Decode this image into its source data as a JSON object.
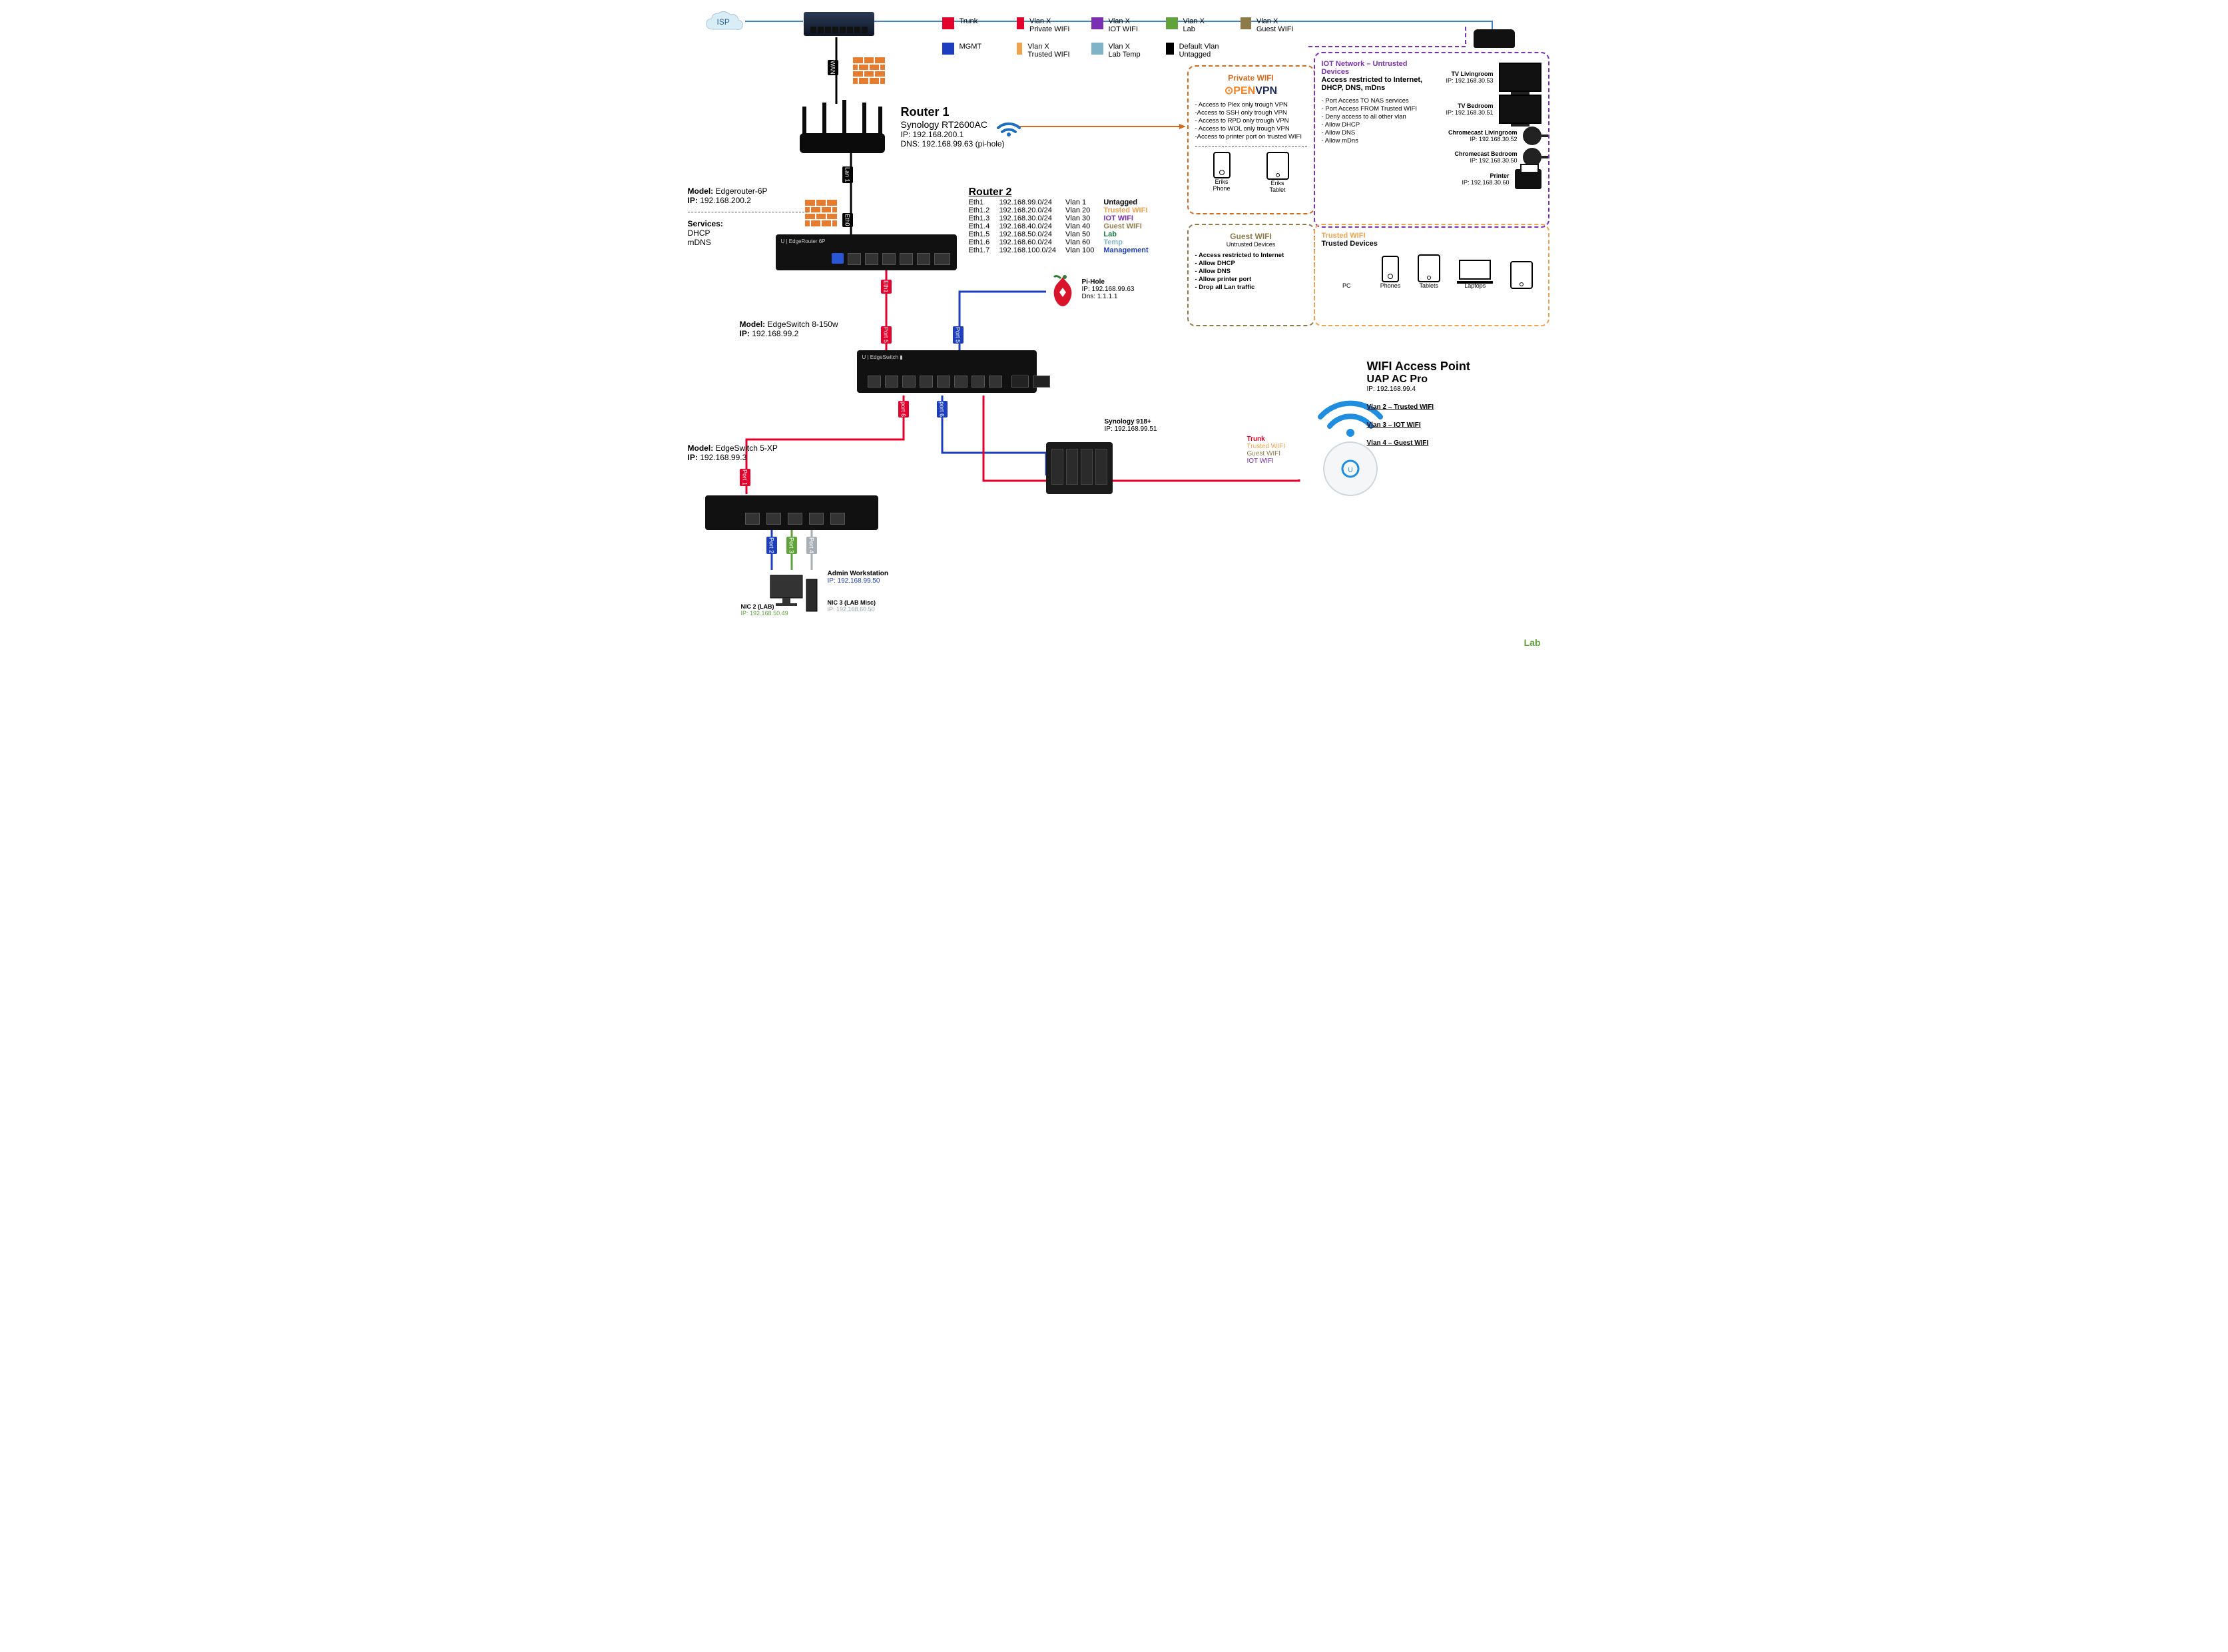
{
  "isp": "ISP",
  "legend": {
    "row1": [
      {
        "color": "#e4002b",
        "label": "Trunk"
      },
      {
        "color": "#e4002b",
        "label": "Vlan X\nPrivate WIFI"
      },
      {
        "color": "#7b2fb5",
        "label": "Vlan X\nIOT WIFI"
      },
      {
        "color": "#5fa33a",
        "label": "Vlan X\nLab"
      },
      {
        "color": "#8d7b4a",
        "label": "Vlan X\nGuest WIFI"
      }
    ],
    "row2": [
      {
        "color": "#1d3fbf",
        "label": "MGMT"
      },
      {
        "color": "#f2a24a",
        "label": "Vlan X\nTrusted WIFI"
      },
      {
        "color": "#7fb4c8",
        "label": "Vlan X\nLab Temp"
      },
      {
        "color": "#000000",
        "label": "Default Vlan\nUntagged"
      }
    ]
  },
  "router1": {
    "title": "Router 1",
    "model": "Synology RT2600AC",
    "ip_label": "IP:",
    "ip": "192.168.200.1",
    "dns_label": "DNS:",
    "dns": "192.168.99.63 (pi-hole)"
  },
  "edgerouter": {
    "model_label": "Model:",
    "model": "Edgerouter-6P",
    "ip_label": "IP:",
    "ip": "192.168.200.2",
    "services_label": "Services:",
    "services": [
      "DHCP",
      "mDNS"
    ]
  },
  "wan_label": "WAN",
  "lan1_label": "Lan 1",
  "eth0_label": "Eth0",
  "router2": {
    "title": "Router 2",
    "rows": [
      {
        "eth": "Eth1",
        "subnet": "192.168.99.0/24",
        "vlan": "Vlan 1",
        "name": "Untagged",
        "color": "#000"
      },
      {
        "eth": "Eth1.2",
        "subnet": "192.168.20.0/24",
        "vlan": "Vlan 20",
        "name": "Trusted WIFI",
        "color": "#f2a24a"
      },
      {
        "eth": "Eth1.3",
        "subnet": "192.168.30.0/24",
        "vlan": "Vlan 30",
        "name": "IOT WIFI",
        "color": "#7b2fb5"
      },
      {
        "eth": "Eth1.4",
        "subnet": "192.168.40.0/24",
        "vlan": "Vlan 40",
        "name": "Guest WIFI",
        "color": "#8d7b4a"
      },
      {
        "eth": "Eth1.5",
        "subnet": "192.168.50.0/24",
        "vlan": "Vlan 50",
        "name": "Lab",
        "color": "#0e7a3e"
      },
      {
        "eth": "Eth1.6",
        "subnet": "192.168.60.0/24",
        "vlan": "Vlan 60",
        "name": "Temp",
        "color": "#7fb4c8"
      },
      {
        "eth": "Eth1.7",
        "subnet": "192.168.100.0/24",
        "vlan": "Vlan 100",
        "name": "Management",
        "color": "#1d3fbf"
      }
    ]
  },
  "pihole": {
    "name": "Pi-Hole",
    "ip_label": "IP:",
    "ip": "192.168.99.63",
    "dns_label": "Dns:",
    "dns": "1.1.1.1"
  },
  "es150": {
    "model_label": "Model:",
    "model": "EdgeSwitch 8-150w",
    "ip_label": "IP:",
    "ip": "192.168.99.2"
  },
  "es5": {
    "model_label": "Model:",
    "model": "EdgeSwitch 5-XP",
    "ip_label": "IP:",
    "ip": "192.168.99.3"
  },
  "nas": {
    "name": "Synology 918+",
    "ip_label": "IP:",
    "ip": "192.168.99.51"
  },
  "workstation": {
    "name": "Admin Workstation",
    "ip_label": "IP:",
    "ip": "192.168.99.50",
    "nic2_name": "NIC 2 (LAB)",
    "nic2_ip_label": "IP:",
    "nic2_ip": "192.168.50.49",
    "nic3_name": "NIC 3 (LAB Misc)",
    "nic3_ip_label": "IP:",
    "nic3_ip": "192.168.60.50"
  },
  "ap": {
    "title": "WIFI Access Point",
    "model": "UAP AC Pro",
    "ip_label": "IP:",
    "ip": "192.168.99.4",
    "v2": "Vlan 2 – Trusted WIFI",
    "v3": "Vlan 3 – IOT WIFI",
    "v4": "Vlan 4 – Guest WIFI",
    "trunk": "Trunk",
    "trusted": "Trusted WIFI",
    "guest": "Guest WIFI",
    "iot": "IOT WIFI"
  },
  "private_box": {
    "title": "Private WIFI",
    "brand": "OPENVPN",
    "rules": [
      "- Access to Plex only trough VPN",
      "-Access to SSH only trough VPN",
      "- Access to RPD only trough VPN",
      "- Access to WOL only trough VPN",
      "-Access to printer port on trusted WIFI"
    ],
    "dev1": "Eriks\nPhone",
    "dev2": "Eriks\nTablet"
  },
  "guest_box": {
    "title": "Guest WIFI",
    "subtitle": "Untrusted Devices",
    "rules": [
      "- Access restricted to Internet",
      "- Allow DHCP",
      "- Allow DNS",
      "- Allow printer port",
      "- Drop all Lan traffic"
    ]
  },
  "iot_box": {
    "title": "IOT Network – Untrusted Devices",
    "subtitle": "Access restricted to Internet, DHCP, DNS, mDns",
    "rules": [
      "- Port Access TO NAS services",
      "- Port Access FROM Trusted WIFI",
      "- Deny access to all other vlan",
      "- Allow DHCP",
      "- Allow DNS",
      "- Allow mDns"
    ],
    "devices": [
      {
        "name": "TV Livingroom",
        "ip": "IP: 192.168.30.53"
      },
      {
        "name": "TV Bedroom",
        "ip": "IP: 192.168.30.51"
      },
      {
        "name": "Chromecast Livingroom",
        "ip": "IP: 192.168.30.52"
      },
      {
        "name": "Chromecast Bedroom",
        "ip": "IP: 192.168.30.50"
      },
      {
        "name": "Printer",
        "ip": "IP: 192.168.30.60"
      }
    ]
  },
  "trusted_box": {
    "title": "Trusted WIFI",
    "subtitle": "Trusted Devices",
    "dev_pc": "PC",
    "dev_phones": "Phones",
    "dev_tablets": "Tablets",
    "dev_laptops": "Laptops"
  },
  "ports": {
    "eth1": "Eth1",
    "p5a": "Port 5",
    "p5b": "Port 5",
    "p6a": "port 6",
    "p6b": "port 6",
    "p1": "Port 1",
    "p2": "Port 2",
    "p3": "Port 3",
    "p4": "Port 4"
  },
  "lab_tag": "Lab"
}
